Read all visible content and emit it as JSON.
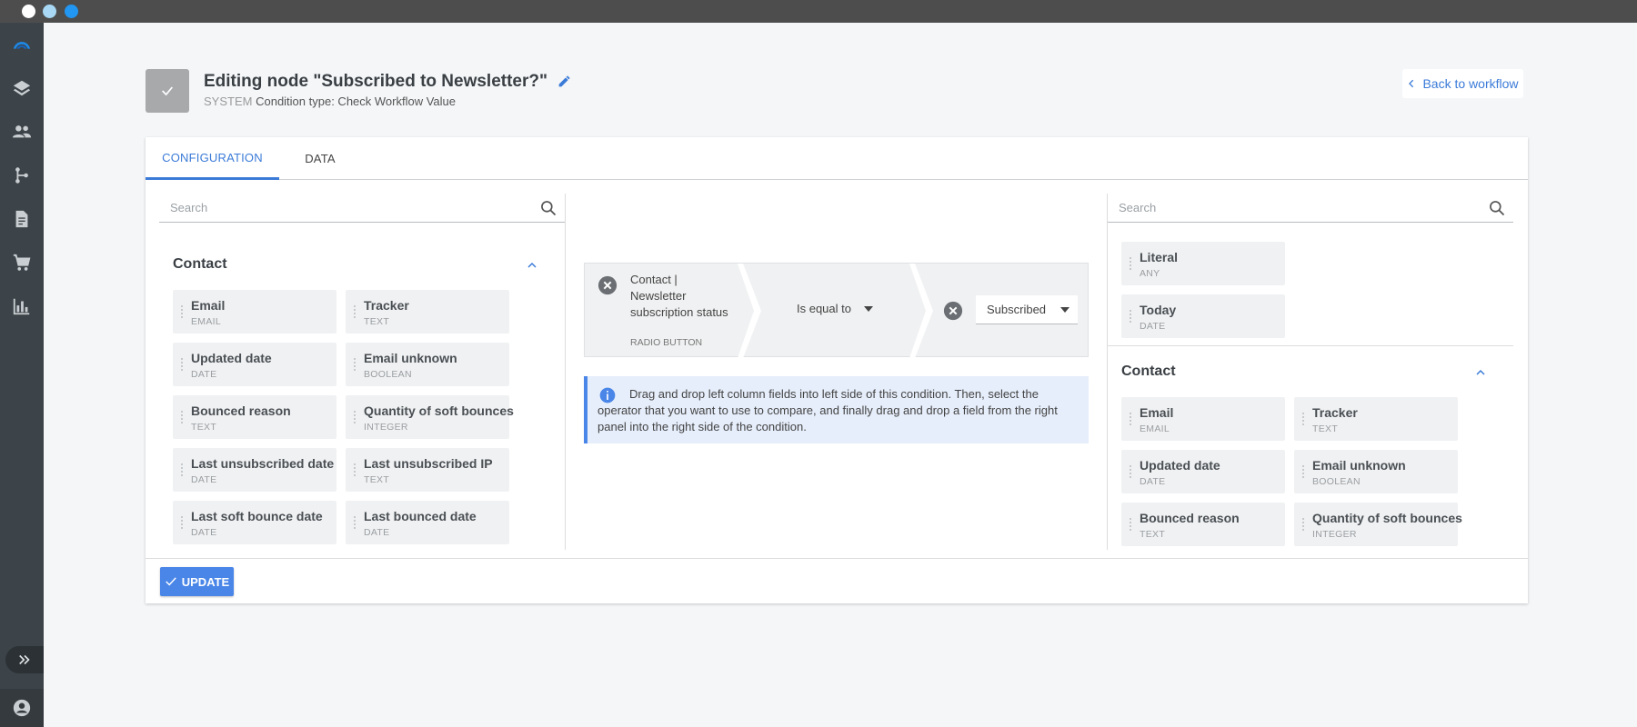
{
  "window": {
    "controls": [
      "close",
      "minimize",
      "maximize"
    ],
    "control_colors": [
      "#ffffff",
      "#a8d8f4",
      "#2196f3"
    ]
  },
  "sidebar": {
    "icons": [
      "logo-icon",
      "layers-icon",
      "contacts-icon",
      "workflow-icon",
      "document-icon",
      "cart-icon",
      "reports-icon"
    ],
    "expand_icon": "double-chevron-right-icon",
    "user_icon": "user-icon"
  },
  "header": {
    "title": "Editing node \"Subscribed to Newsletter?\"",
    "system_label": "SYSTEM",
    "subtitle": "Condition type: Check Workflow Value",
    "back_label": "Back to workflow"
  },
  "tabs": [
    {
      "label": "CONFIGURATION",
      "active": true
    },
    {
      "label": "DATA",
      "active": false
    }
  ],
  "left_panel": {
    "search_placeholder": "Search",
    "section_title": "Contact",
    "fields": [
      {
        "name": "Email",
        "type": "EMAIL"
      },
      {
        "name": "Tracker",
        "type": "TEXT"
      },
      {
        "name": "Updated date",
        "type": "DATE"
      },
      {
        "name": "Email unknown",
        "type": "BOOLEAN"
      },
      {
        "name": "Bounced reason",
        "type": "TEXT"
      },
      {
        "name": "Quantity of soft bounces",
        "type": "INTEGER"
      },
      {
        "name": "Last unsubscribed date",
        "type": "DATE"
      },
      {
        "name": "Last unsubscribed IP",
        "type": "TEXT"
      },
      {
        "name": "Last soft bounce date",
        "type": "DATE"
      },
      {
        "name": "Last bounced date",
        "type": "DATE"
      }
    ]
  },
  "condition": {
    "left_value": "Contact | Newsletter subscription status",
    "left_type": "RADIO BUTTON",
    "operator": "Is equal to",
    "right_value": "Subscribed"
  },
  "info": {
    "text": "Drag and drop left column fields into left side of this condition. Then, select the operator that you want to use to compare, and finally drag and drop a field from the right panel into the right side of the condition."
  },
  "right_panel": {
    "search_placeholder": "Search",
    "generic_fields": [
      {
        "name": "Literal",
        "type": "ANY"
      },
      {
        "name": "Today",
        "type": "DATE"
      }
    ],
    "section_title": "Contact",
    "fields": [
      {
        "name": "Email",
        "type": "EMAIL"
      },
      {
        "name": "Tracker",
        "type": "TEXT"
      },
      {
        "name": "Updated date",
        "type": "DATE"
      },
      {
        "name": "Email unknown",
        "type": "BOOLEAN"
      },
      {
        "name": "Bounced reason",
        "type": "TEXT"
      },
      {
        "name": "Quantity of soft bounces",
        "type": "INTEGER"
      }
    ]
  },
  "footer": {
    "update_label": "UPDATE"
  },
  "colors": {
    "accent": "#3b7bd8",
    "button": "#4a86e8",
    "sidebar": "#3d4449",
    "info_bg": "#e6eefb"
  }
}
